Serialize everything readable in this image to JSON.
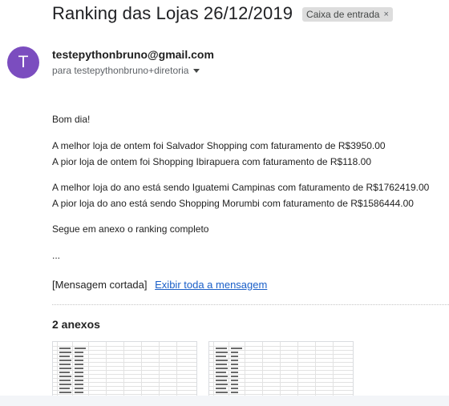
{
  "email": {
    "subject": "Ranking das Lojas 26/12/2019",
    "label": "Caixa de entrada",
    "label_remove": "×",
    "avatar_letter": "T",
    "avatar_color": "#7b4dbf",
    "sender": "testepythonbruno@gmail.com",
    "recipient": "para testepythonbruno+diretoria",
    "body": [
      "Bom dia!",
      "A melhor loja de ontem foi Salvador Shopping com faturamento de R$3950.00",
      "A pior loja de ontem foi Shopping Ibirapuera com faturamento de R$118.00",
      "A melhor loja do ano está sendo Iguatemi Campinas com faturamento de R$1762419.00",
      "A pior loja do ano está sendo Shopping Morumbi com faturamento de R$1586444.00",
      "Segue em anexo o ranking completo",
      "..."
    ],
    "truncated_text": "[Mensagem cortada]",
    "view_full_link": "Exibir toda a mensagem",
    "link_color": "#1a5fc8"
  },
  "attachments": {
    "title": "2 anexos"
  }
}
